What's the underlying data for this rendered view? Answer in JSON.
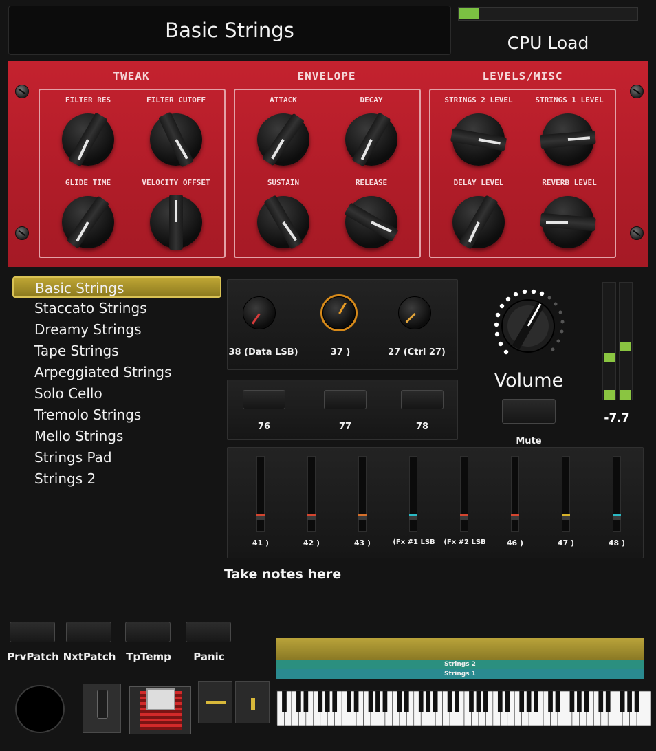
{
  "title": "Basic Strings",
  "cpu": {
    "label": "CPU Load",
    "level": 0.1,
    "fill_color": "#7bc142"
  },
  "panel": {
    "accent": "#b01c28",
    "sections": [
      {
        "title": "TWEAK",
        "knobs": [
          "FILTER RES",
          "FILTER CUTOFF",
          "GLIDE TIME",
          "VELOCITY OFFSET"
        ]
      },
      {
        "title": "ENVELOPE",
        "knobs": [
          "ATTACK",
          "DECAY",
          "SUSTAIN",
          "RELEASE"
        ]
      },
      {
        "title": "LEVELS/MISC",
        "knobs": [
          "STRINGS 2 LEVEL",
          "STRINGS 1 LEVEL",
          "DELAY LEVEL",
          "REVERB LEVEL"
        ]
      }
    ]
  },
  "presets": {
    "selected": "Basic Strings",
    "items": [
      "Basic Strings",
      "Staccato Strings",
      "Dreamy Strings",
      "Tape Strings",
      "Arpeggiated Strings",
      "Solo Cello",
      "Tremolo Strings",
      "Mello Strings",
      "Strings Pad",
      "Strings 2"
    ]
  },
  "controls": {
    "knobs": [
      "38 (Data LSB)",
      "37 )",
      "27 (Ctrl 27)"
    ],
    "buttons": [
      "76",
      "77",
      "78"
    ],
    "faders": [
      "41 )",
      "42 )",
      "43 )",
      "(Fx #1 LSB",
      "(Fx #2 LSB",
      "46 )",
      "47 )",
      "48 )"
    ]
  },
  "volume": {
    "label": "Volume",
    "mute_label": "Mute",
    "level_db": "-7.7"
  },
  "notes": {
    "placeholder": "Take notes here"
  },
  "pads": [
    "PrvPatch",
    "NxtPatch",
    "TpTemp",
    "Panic"
  ],
  "layers": [
    "Strings 2",
    "Strings 1"
  ]
}
